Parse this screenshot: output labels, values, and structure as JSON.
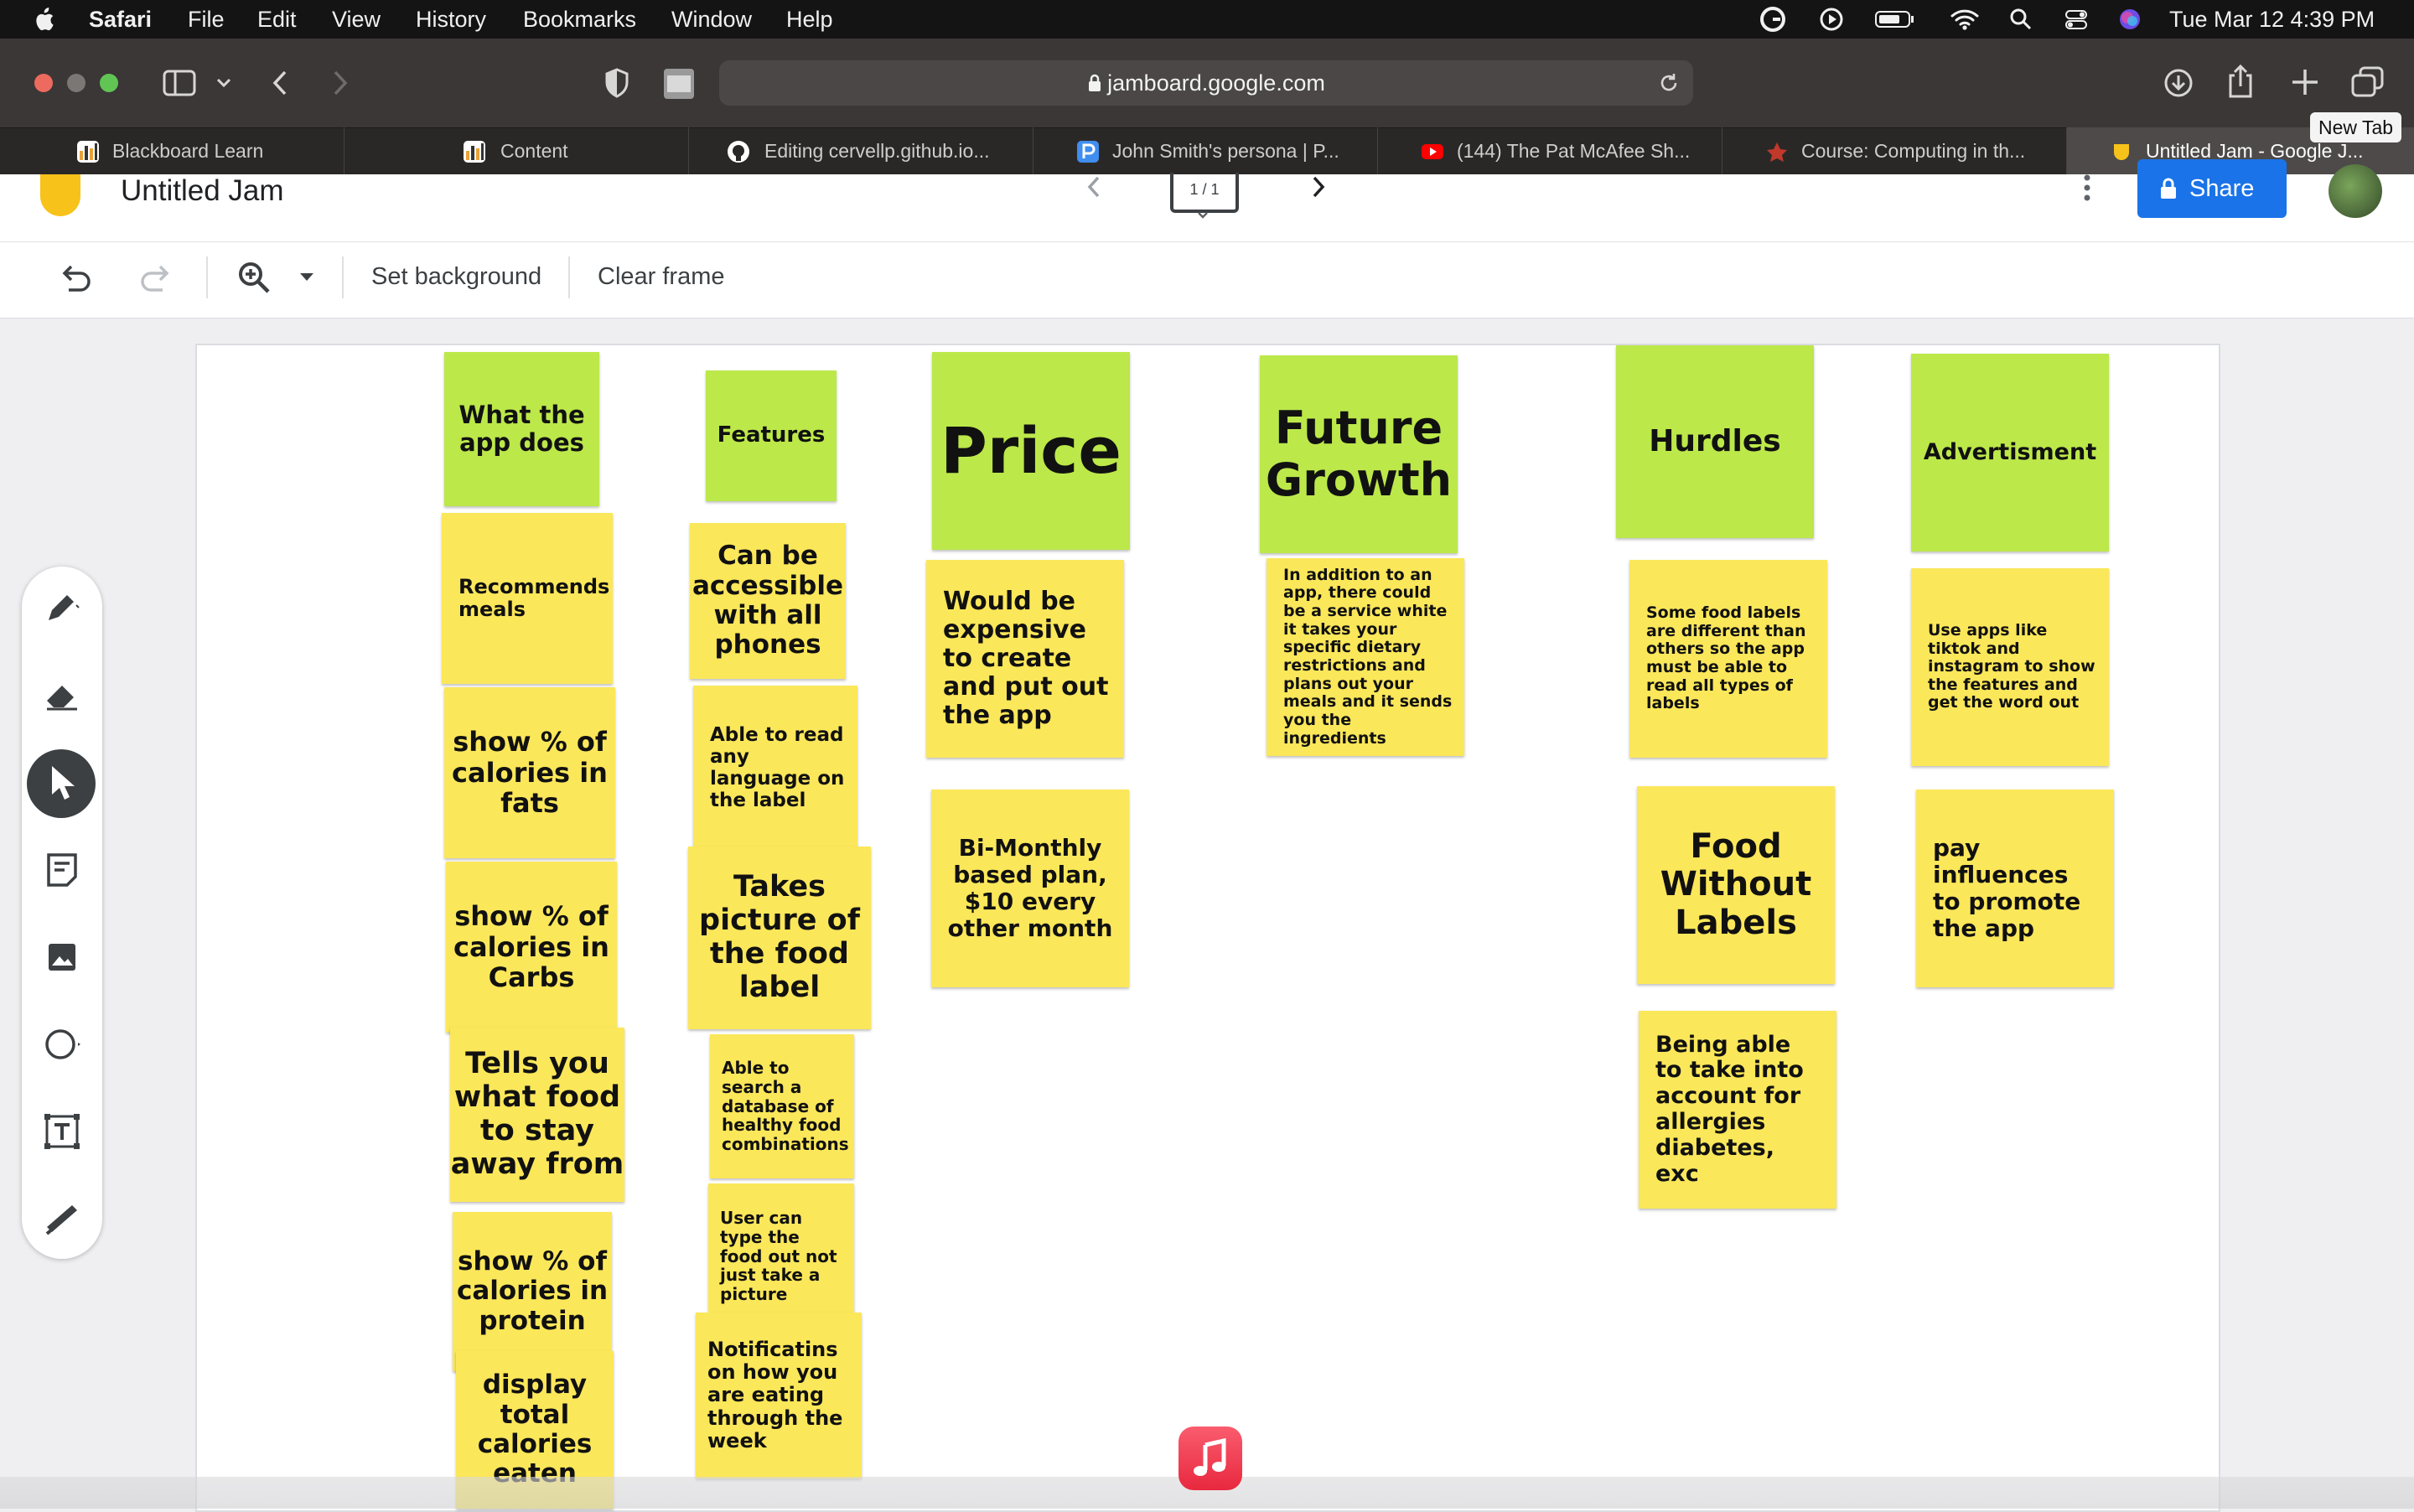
{
  "menubar": {
    "app": "Safari",
    "items": [
      "File",
      "Edit",
      "View",
      "History",
      "Bookmarks",
      "Window",
      "Help"
    ],
    "clock": "Tue Mar 12  4:39 PM"
  },
  "browser": {
    "url": "jamboard.google.com",
    "new_tab_tooltip": "New Tab",
    "tabs": [
      {
        "title": "Blackboard Learn",
        "icon": "chart-bar-icon",
        "color": "#e8a23a"
      },
      {
        "title": "Content",
        "icon": "chart-bar-icon",
        "color": "#e8a23a"
      },
      {
        "title": "Editing cervellp.github.io...",
        "icon": "github-icon",
        "color": "#ffffff"
      },
      {
        "title": "John Smith's persona | P...",
        "icon": "p-logo-icon",
        "color": "#3f8ef0"
      },
      {
        "title": "(144) The Pat McAfee Sh...",
        "icon": "youtube-icon",
        "color": "#ff0000"
      },
      {
        "title": "Course: Computing in th...",
        "icon": "course-icon",
        "color": "#c0392b"
      },
      {
        "title": "Untitled Jam - Google J...",
        "icon": "jamboard-icon",
        "color": "#f7c21a"
      }
    ]
  },
  "jam": {
    "title": "Untitled Jam",
    "frame_indicator": "1 / 1",
    "share_label": "Share",
    "set_background": "Set background",
    "clear_frame": "Clear frame"
  },
  "colors": {
    "yellow_note": "#fbe75a",
    "green_note": "#bce84a",
    "share_blue": "#1a73e8"
  },
  "notes": [
    {
      "text": "What the app does",
      "color": "green",
      "size": "md"
    },
    {
      "text": "Recommends meals",
      "color": "yellow",
      "size": "sm"
    },
    {
      "text": "show % of calories in fats",
      "color": "yellow",
      "size": "lg"
    },
    {
      "text": "show % of calories in Carbs",
      "color": "yellow",
      "size": "lg"
    },
    {
      "text": "Tells you what food to stay away from",
      "color": "yellow",
      "size": "lg"
    },
    {
      "text": "show % of calories in protein",
      "color": "yellow",
      "size": "lg"
    },
    {
      "text": "display total calories eaten",
      "color": "yellow",
      "size": "lg"
    },
    {
      "text": "Features",
      "color": "green",
      "size": "sm"
    },
    {
      "text": "Can be accessible with all phones",
      "color": "yellow",
      "size": "md"
    },
    {
      "text": "Able to read any language on the label",
      "color": "yellow",
      "size": "sm"
    },
    {
      "text": "Takes picture of the food label",
      "color": "yellow",
      "size": "lg"
    },
    {
      "text": "Able to search a database of healthy food combinations",
      "color": "yellow",
      "size": "xs"
    },
    {
      "text": "User can type the food out not just take a picture",
      "color": "yellow",
      "size": "xs"
    },
    {
      "text": "Notificatins on how you are eating through the week",
      "color": "yellow",
      "size": "sm"
    },
    {
      "text": "Price",
      "color": "green",
      "size": "xxl"
    },
    {
      "text": "Would be expensive to create and put out the app",
      "color": "yellow",
      "size": "md"
    },
    {
      "text": "Bi-Monthly based plan, $10 every other month",
      "color": "yellow",
      "size": "md"
    },
    {
      "text": "Future Growth",
      "color": "green",
      "size": "xl"
    },
    {
      "text": "In addition to an app, there could be a service white it takes your specific dietary restrictions and plans out your meals and it sends you the ingredients",
      "color": "yellow",
      "size": "xs"
    },
    {
      "text": "Hurdles",
      "color": "green",
      "size": "md"
    },
    {
      "text": "Some food labels are different than others so the app must be able to read all types of labels",
      "color": "yellow",
      "size": "xs"
    },
    {
      "text": "Food Without Labels",
      "color": "yellow",
      "size": "lg"
    },
    {
      "text": "Being able to take into account for allergies diabetes, exc",
      "color": "yellow",
      "size": "md"
    },
    {
      "text": "Advertisment",
      "color": "green",
      "size": "sm"
    },
    {
      "text": "Use apps like tiktok and instagram to show the features and get the word out",
      "color": "yellow",
      "size": "xs"
    },
    {
      "text": "pay influences to promote the app",
      "color": "yellow",
      "size": "md"
    }
  ]
}
